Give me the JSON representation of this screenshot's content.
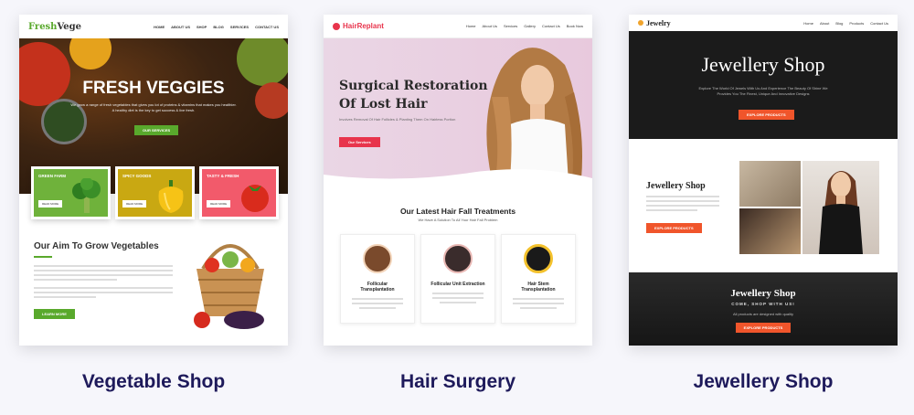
{
  "cards": [
    {
      "caption": "Vegetable Shop",
      "logo": {
        "part1": "Fresh",
        "part2": "Vege"
      },
      "nav": [
        "HOME",
        "ABOUT US",
        "SHOP",
        "BLOG",
        "SERVICES",
        "CONTACT US"
      ],
      "hero_title": "FRESH VEGGIES",
      "hero_text_1": "We grow a range of fresh vegetables that gives you lot of proteins & vitamins that makes you healthier.",
      "hero_text_2": "A healthy diet is the key to get success & live fresh.",
      "hero_button": "OUR SERVICES",
      "features": [
        {
          "title": "GREEN FARM",
          "button": "READ MORE"
        },
        {
          "title": "SPICY GOODS",
          "button": "READ MORE"
        },
        {
          "title": "TASTY & FRESH",
          "button": "READ MORE"
        }
      ],
      "section_title": "Our Aim To Grow Vegetables",
      "section_button": "LEARN MORE"
    },
    {
      "caption": "Hair Surgery",
      "logo": {
        "part1": "Hair",
        "part2": "Replant"
      },
      "nav": [
        "Home",
        "About Us",
        "Services",
        "Gallery",
        "Contact Us",
        "Book Now"
      ],
      "hero_title_1": "Surgical Restoration",
      "hero_title_2": "Of Lost Hair",
      "hero_text": "Involves Removal Of Hair Follicles & Planting Them On Hairless Portion",
      "hero_button": "Our Services",
      "section_title": "Our Latest Hair Fall Treatments",
      "section_subtitle": "We Have A Solution To All Your Hair Fall Problem",
      "treatments": [
        {
          "title": "Follicular Transplantation"
        },
        {
          "title": "Follicular Unit Extraction"
        },
        {
          "title": "Hair Stem Transplantation"
        }
      ]
    },
    {
      "caption": "Jewellery Shop",
      "logo": "Jewelry",
      "nav": [
        "Home",
        "About",
        "Blog",
        "Products",
        "Contact Us"
      ],
      "hero_title": "Jewellery Shop",
      "hero_text": "Explore The World Of Jewels With Us And Experience The Beauty Of Shine We Provides You The Finest, Unique And Innovative Designs",
      "hero_button": "EXPLORE PRODUCTS",
      "about_title": "Jewellery Shop",
      "about_button": "EXPLORE PRODUCTS",
      "bottom_title": "Jewellery Shop",
      "bottom_subtitle": "COME, SHOP WITH US!",
      "bottom_text": "All products are designed with quality",
      "bottom_button": "EXPLORE PRODUCTS"
    }
  ],
  "colors": {
    "veg_green": "#59a92c",
    "hair_red": "#e8344c",
    "jewel_orange": "#f0552b",
    "caption_navy": "#1e1a5b"
  }
}
